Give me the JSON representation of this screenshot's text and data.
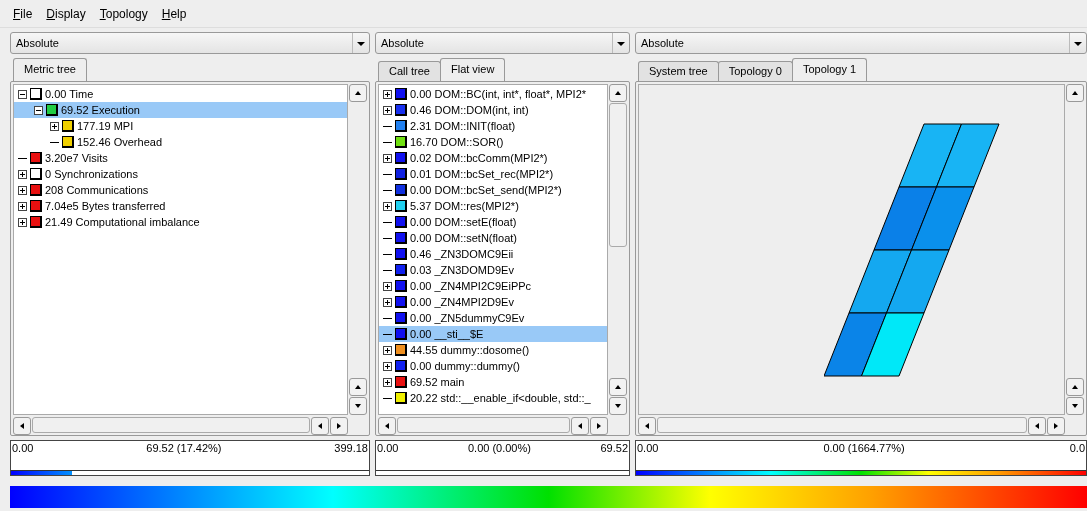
{
  "menu": [
    "File",
    "Display",
    "Topology",
    "Help"
  ],
  "panels": [
    {
      "kind": "tree",
      "mode": "Absolute",
      "tabs": [
        {
          "label": "Metric tree",
          "selected": true
        }
      ],
      "tree": [
        {
          "label": "0.00 Time",
          "color": "#ffffff",
          "kind": "branch",
          "expanded": true,
          "selected": false,
          "children": [
            {
              "label": "69.52 Execution",
              "color": "#22cc44",
              "kind": "branch",
              "expanded": true,
              "selected": true,
              "children": [
                {
                  "label": "177.19 MPI",
                  "color": "#f0d000",
                  "kind": "branch",
                  "expanded": false,
                  "selected": false
                },
                {
                  "label": "152.46 Overhead",
                  "color": "#f0d000",
                  "kind": "leaf",
                  "selected": false
                }
              ]
            }
          ]
        },
        {
          "label": "3.20e7 Visits",
          "color": "#e81010",
          "kind": "leaf",
          "selected": false
        },
        {
          "label": "0 Synchronizations",
          "color": "#ffffff",
          "kind": "branch",
          "expanded": false,
          "selected": false
        },
        {
          "label": "208 Communications",
          "color": "#e81010",
          "kind": "branch",
          "expanded": false,
          "selected": false
        },
        {
          "label": "7.04e5 Bytes transferred",
          "color": "#e81010",
          "kind": "branch",
          "expanded": false,
          "selected": false
        },
        {
          "label": "21.49 Computational imbalance",
          "color": "#e81010",
          "kind": "branch",
          "expanded": false,
          "selected": false
        }
      ],
      "legend": {
        "min": "0.00",
        "value": "69.52 (17.42%)",
        "max": "399.18",
        "level": 0.17
      }
    },
    {
      "kind": "tree",
      "mode": "Absolute",
      "tabs": [
        {
          "label": "Call tree",
          "selected": false
        },
        {
          "label": "Flat view",
          "selected": true
        }
      ],
      "tree": [
        {
          "label": "0.00 DOM::BC(int, int*, float*, MPI2*",
          "color": "#1010f0",
          "kind": "branch",
          "expanded": false,
          "selected": false
        },
        {
          "label": "0.46 DOM::DOM(int, int)",
          "color": "#1830f0",
          "kind": "branch",
          "expanded": false,
          "selected": false
        },
        {
          "label": "2.31 DOM::INIT(float)",
          "color": "#2080f0",
          "kind": "leaf",
          "selected": false
        },
        {
          "label": "16.70 DOM::SOR()",
          "color": "#70e010",
          "kind": "leaf",
          "selected": false
        },
        {
          "label": "0.02 DOM::bcComm(MPI2*)",
          "color": "#1010f0",
          "kind": "branch",
          "expanded": false,
          "selected": false
        },
        {
          "label": "0.01 DOM::bcSet_rec(MPI2*)",
          "color": "#1020e0",
          "kind": "leaf",
          "selected": false
        },
        {
          "label": "0.00 DOM::bcSet_send(MPI2*)",
          "color": "#1030e0",
          "kind": "leaf",
          "selected": false
        },
        {
          "label": "5.37 DOM::res(MPI2*)",
          "color": "#20d0f0",
          "kind": "branch",
          "expanded": false,
          "selected": false
        },
        {
          "label": "0.00 DOM::setE(float)",
          "color": "#1010f0",
          "kind": "leaf",
          "selected": false
        },
        {
          "label": "0.00 DOM::setN(float)",
          "color": "#1010f0",
          "kind": "leaf",
          "selected": false
        },
        {
          "label": "0.46 _ZN3DOMC9Eii",
          "color": "#1010f0",
          "kind": "leaf",
          "selected": false
        },
        {
          "label": "0.03 _ZN3DOMD9Ev",
          "color": "#1020f0",
          "kind": "leaf",
          "selected": false
        },
        {
          "label": "0.00 _ZN4MPI2C9EiPPc",
          "color": "#1010f0",
          "kind": "branch",
          "expanded": false,
          "selected": false
        },
        {
          "label": "0.00 _ZN4MPI2D9Ev",
          "color": "#1010f0",
          "kind": "branch",
          "expanded": false,
          "selected": false
        },
        {
          "label": "0.00 _ZN5dummyC9Ev",
          "color": "#1010f0",
          "kind": "leaf",
          "selected": false
        },
        {
          "label": "0.00 __sti__$E",
          "color": "#1010f0",
          "kind": "leaf",
          "selected": true
        },
        {
          "label": "44.55 dummy::dosome()",
          "color": "#f09020",
          "kind": "branch",
          "expanded": false,
          "selected": false
        },
        {
          "label": "0.00 dummy::dummy()",
          "color": "#1020f0",
          "kind": "branch",
          "expanded": false,
          "selected": false
        },
        {
          "label": "69.52 main",
          "color": "#e81010",
          "kind": "branch",
          "expanded": false,
          "selected": false
        },
        {
          "label": "20.22 std::__enable_if<double, std::_",
          "color": "#f0f000",
          "kind": "leaf",
          "selected": false
        }
      ],
      "legend": {
        "min": "0.00",
        "value": "0.00 (0.00%)",
        "max": "69.52"
      }
    },
    {
      "kind": "topology",
      "mode": "Absolute",
      "tabs": [
        {
          "label": "System tree",
          "selected": false
        },
        {
          "label": "Topology 0",
          "selected": false
        },
        {
          "label": "Topology 1",
          "selected": true
        }
      ],
      "cells": [
        {
          "color": "#18b4f4"
        },
        {
          "color": "#18b4f4"
        },
        {
          "color": "#0a80e8"
        },
        {
          "color": "#0a90ec"
        },
        {
          "color": "#14a8f0"
        },
        {
          "color": "#14a8f0"
        },
        {
          "color": "#0a84e8"
        },
        {
          "color": "#00e8f8"
        }
      ],
      "legend": {
        "min": "0.00",
        "value": "0.00 (1664.77%)",
        "max": "0.0",
        "level": 1
      }
    }
  ]
}
